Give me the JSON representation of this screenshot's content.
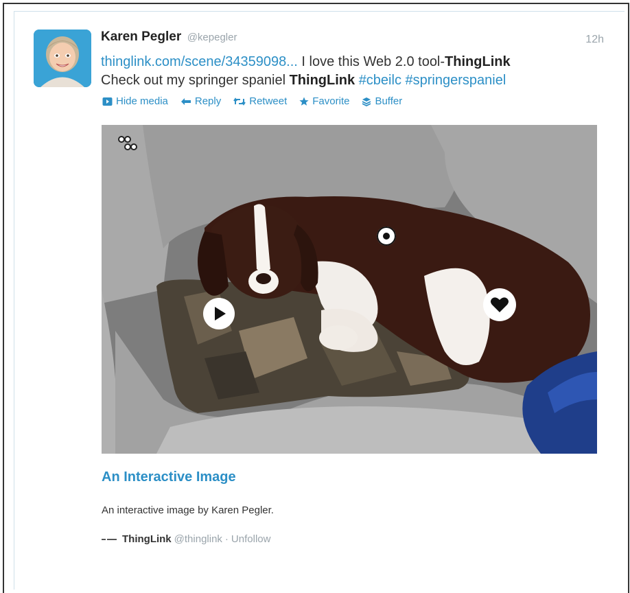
{
  "tweet": {
    "author_name": "Karen Pegler",
    "author_handle": "@kepegler",
    "timestamp": "12h",
    "link_text": "thinglink.com/scene/34359098...",
    "text_part1": " I love this Web 2.0 tool-",
    "text_bold1": "ThingLink",
    "text_part2": "Check out my springer spaniel ",
    "text_bold2": "ThingLink",
    "hashtag1": "#cbeilc",
    "hashtag2": "#springerspaniel"
  },
  "actions": {
    "hide_media": "Hide media",
    "reply": "Reply",
    "retweet": "Retweet",
    "favorite": "Favorite",
    "buffer": "Buffer"
  },
  "card": {
    "title": "An Interactive Image",
    "description": "An interactive image by Karen Pegler.",
    "source_name": "ThingLink",
    "source_handle": "@thinglink",
    "separator": "·",
    "unfollow": "Unfollow"
  },
  "colors": {
    "link_blue": "#2c8fc6",
    "muted_gray": "#9aa4ab"
  },
  "icons": [
    "hide-media-icon",
    "reply-icon",
    "retweet-icon",
    "favorite-icon",
    "buffer-icon",
    "play-icon",
    "info-icon",
    "heart-icon",
    "thinglink-logo-icon"
  ]
}
